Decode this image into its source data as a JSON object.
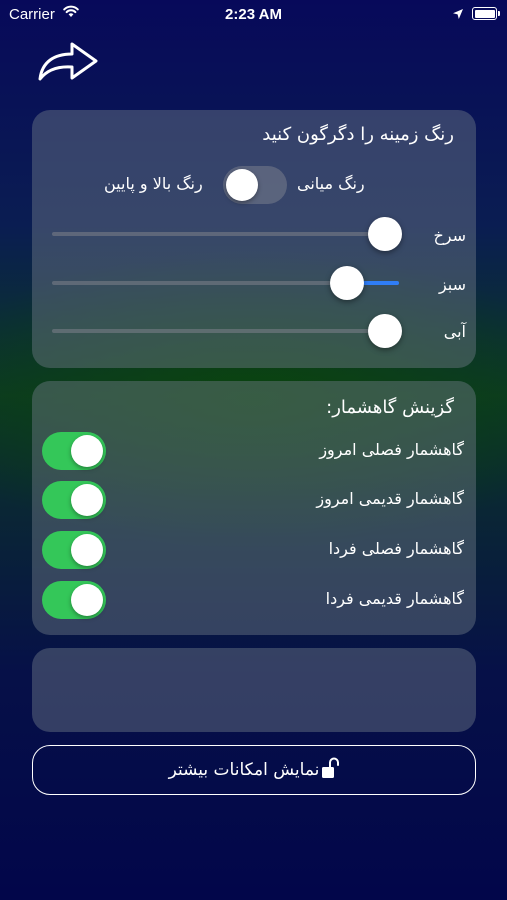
{
  "status_bar": {
    "carrier": "Carrier",
    "time": "2:23 AM"
  },
  "icons": {
    "share": "share-arrow-icon",
    "wifi": "wifi-icon",
    "location": "location-arrow-icon",
    "battery": "battery-icon",
    "lock": "unlock-icon"
  },
  "color_card": {
    "title": "رنگ زمینه را دگرگون کنید",
    "mode_left_label": "رنگ بالا و پایین",
    "mode_right_label": "رنگ میانی",
    "mode_switch_on": false,
    "sliders": [
      {
        "label": "سرخ",
        "value": 0.96
      },
      {
        "label": "سبز",
        "value": 0.85
      },
      {
        "label": "آبی",
        "value": 0.96
      }
    ]
  },
  "calendar_card": {
    "title": "گزینش گاهشمار:",
    "options": [
      {
        "label": "گاهشمار فصلی امروز",
        "on": true
      },
      {
        "label": "گاهشمار قدیمی امروز",
        "on": true
      },
      {
        "label": "گاهشمار فصلی فردا",
        "on": true
      },
      {
        "label": "گاهشمار قدیمی فردا",
        "on": true
      }
    ]
  },
  "more_button": {
    "label": "نمایش امکانات بیشتر"
  },
  "colors": {
    "switch_on": "#34c759",
    "slider_fill": "#2f7df6"
  }
}
